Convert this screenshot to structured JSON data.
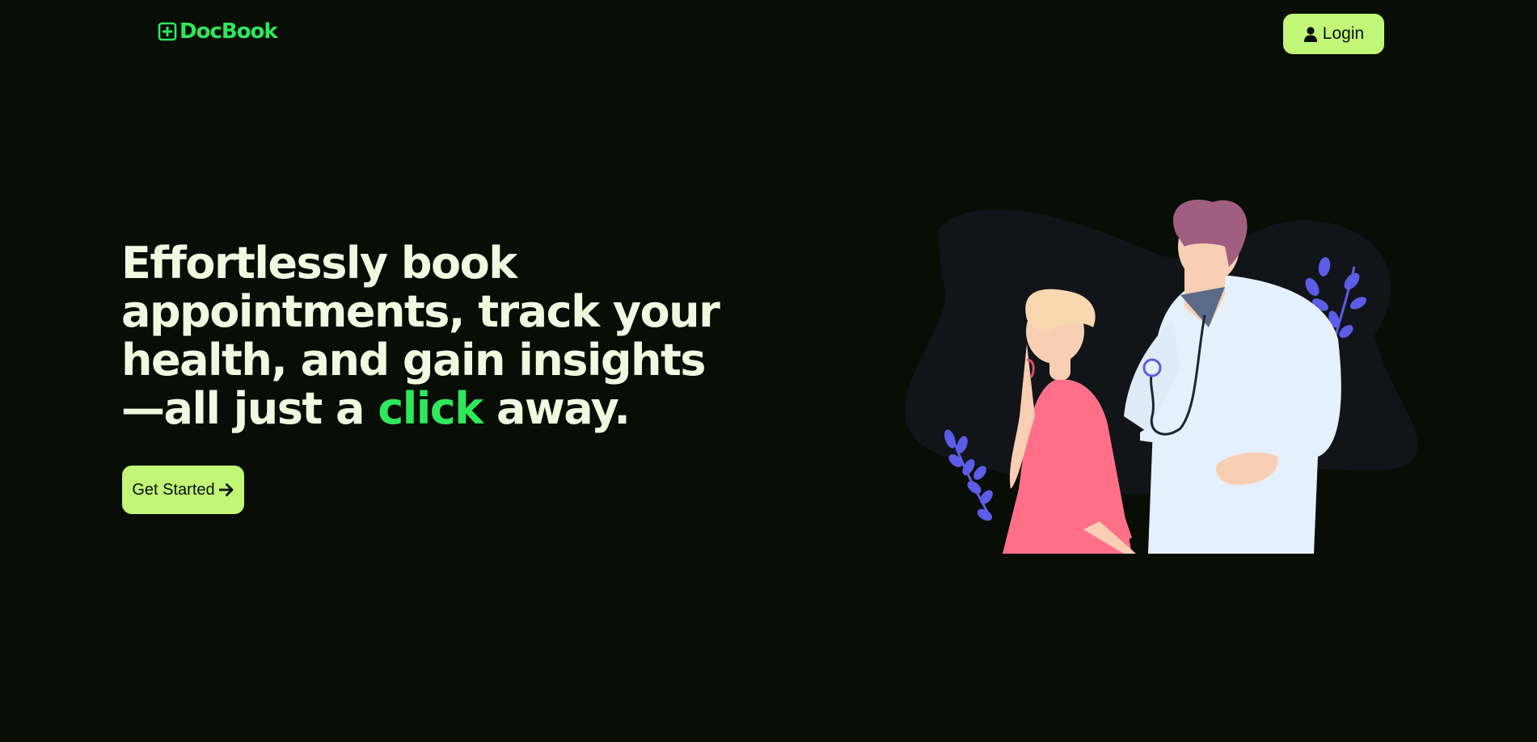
{
  "header": {
    "logo": {
      "text": "DocBook",
      "icon": "plus-square-icon"
    },
    "login_button": {
      "label": "Login",
      "icon": "user-icon"
    }
  },
  "hero": {
    "headline_part1": "Effortlessly book appointments, track your health, and gain insights —all just a ",
    "headline_accent": "click",
    "headline_part2": " away.",
    "cta_button": {
      "label": "Get Started",
      "icon": "arrow-right-icon"
    },
    "illustration": "doctor-patient-illustration"
  },
  "colors": {
    "background": "#080d05",
    "brand_green": "#2ee85a",
    "button_lime": "#c1f677",
    "headline_text": "#f1fae0",
    "button_text": "#0b0f07"
  }
}
